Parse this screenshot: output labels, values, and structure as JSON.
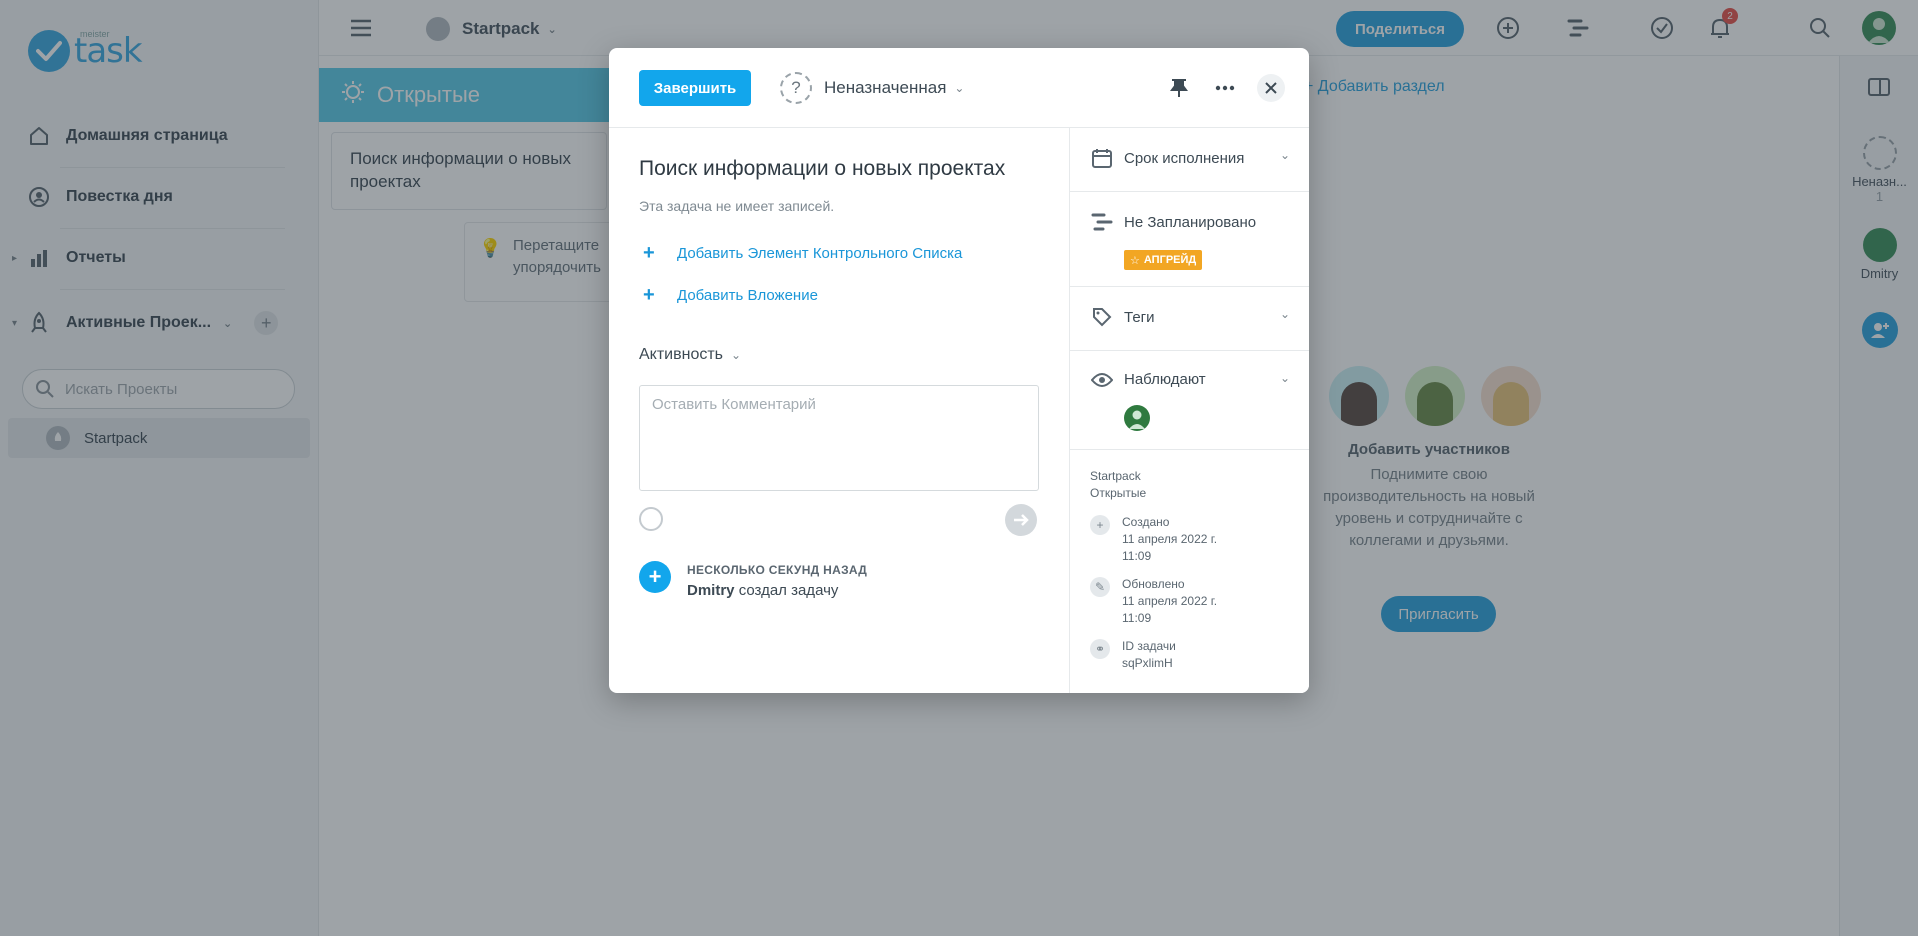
{
  "app": {
    "logo_small": "meister",
    "logo_big": "task",
    "brand_color": "#12a6ec"
  },
  "sidebar": {
    "items": [
      {
        "label": "Домашняя страница",
        "icon": "home-icon"
      },
      {
        "label": "Повестка дня",
        "icon": "agenda-icon"
      },
      {
        "label": "Отчеты",
        "icon": "bar-chart-icon"
      }
    ],
    "active_projects_label": "Активные Проек...",
    "search_placeholder": "Искать Проекты",
    "project": "Startpack"
  },
  "topbar": {
    "project_name": "Startpack",
    "share_label": "Поделиться",
    "notification_count": "2"
  },
  "board": {
    "section_name": "Открытые",
    "task_card": "Поиск информации о новых проектах",
    "tip_text": "Перетащите упорядочить",
    "add_section": "Добавить раздел",
    "invite_title": "Добавить участников",
    "invite_text": "Поднимите свою производительность на новый уровень и сотрудничайте с коллегами и друзьями.",
    "invite_button": "Пригласить"
  },
  "right_rail": {
    "unassigned_label": "Неназн...",
    "unassigned_count": "1",
    "user_label": "Dmitry"
  },
  "modal": {
    "complete_label": "Завершить",
    "assignee": "Неназначенная",
    "task_title": "Поиск информации о новых проектах",
    "no_notes": "Эта задача не имеет записей.",
    "add_checklist": "Добавить Элемент Контрольного Списка",
    "add_attachment": "Добавить Вложение",
    "activity_label": "Активность",
    "comment_placeholder": "Оставить Комментарий",
    "activity_time": "НЕСКОЛЬКО СЕКУНД НАЗАД",
    "activity_user": "Dmitry",
    "activity_action": "создал задачу",
    "due_date_label": "Срок исполнения",
    "schedule_label": "Не Запланировано",
    "upgrade_label": "АПГРЕЙД",
    "tags_label": "Теги",
    "watchers_label": "Наблюдают",
    "meta_project": "Startpack",
    "meta_section": "Открытые",
    "created_label": "Создано",
    "created_date": "11 апреля 2022 г.",
    "created_time": "11:09",
    "updated_label": "Обновлено",
    "updated_date": "11 апреля 2022 г.",
    "updated_time": "11:09",
    "task_id_label": "ID задачи",
    "task_id": "sqPxlimH"
  }
}
